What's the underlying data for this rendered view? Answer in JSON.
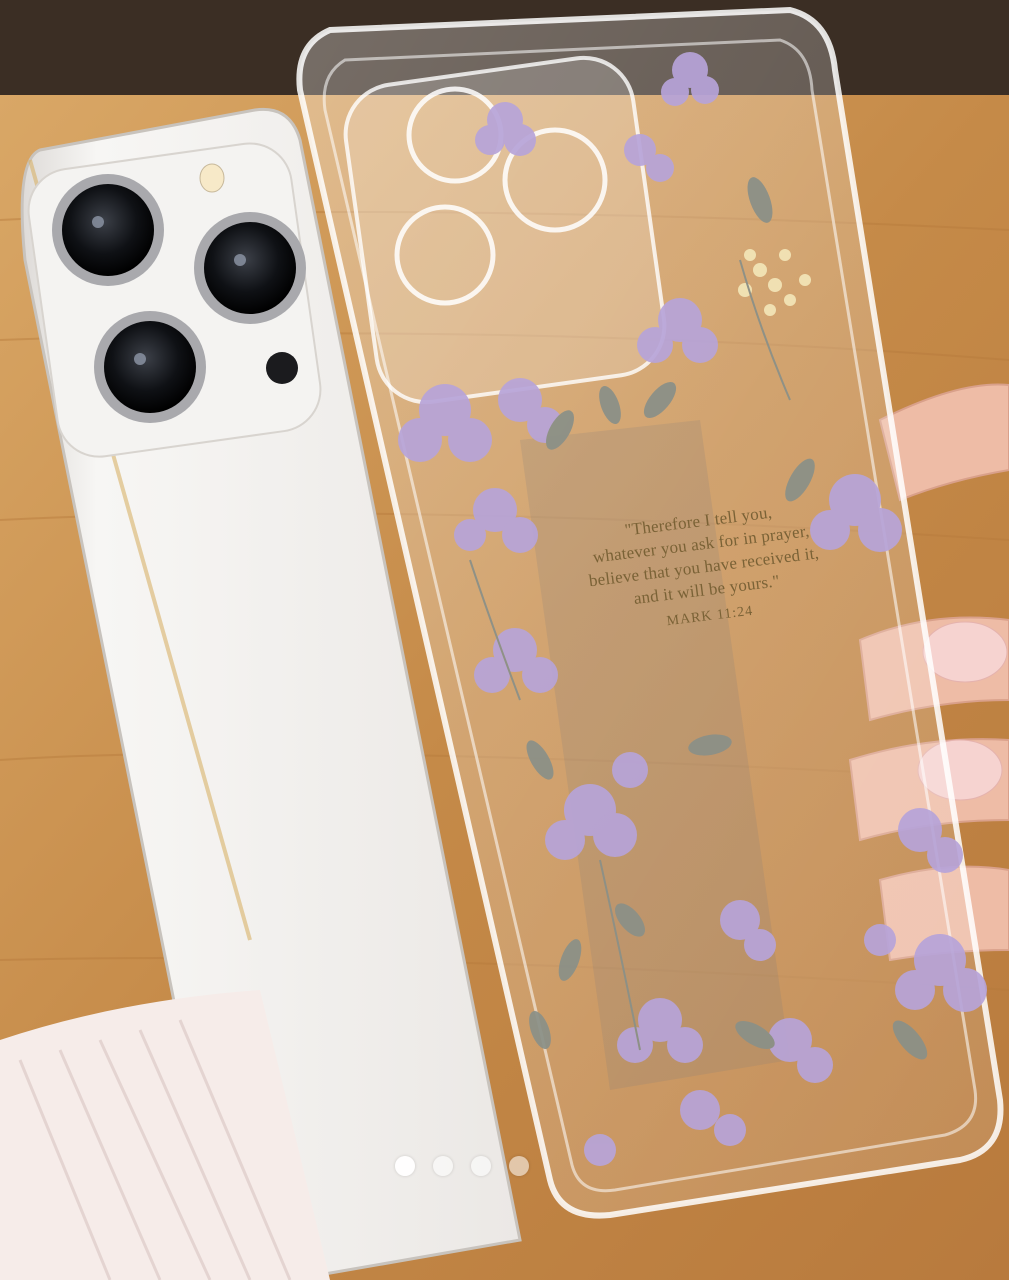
{
  "product_photo": {
    "quote": {
      "line1": "\"Therefore I tell you,",
      "line2": "whatever you ask for in prayer,",
      "line3": "believe that you have received it,",
      "line4": "and it will be yours.\"",
      "reference": "MARK 11:24"
    },
    "carousel": {
      "dots": [
        "image-1",
        "image-2",
        "image-3",
        "image-4"
      ],
      "active_index": 0
    },
    "colors": {
      "table_wood": "#c9914f",
      "phone_white": "#f1efed",
      "flower_lavender": "#b7a4d9",
      "leaf_grey": "#8a9088",
      "quote_gold": "#7a6236"
    }
  }
}
